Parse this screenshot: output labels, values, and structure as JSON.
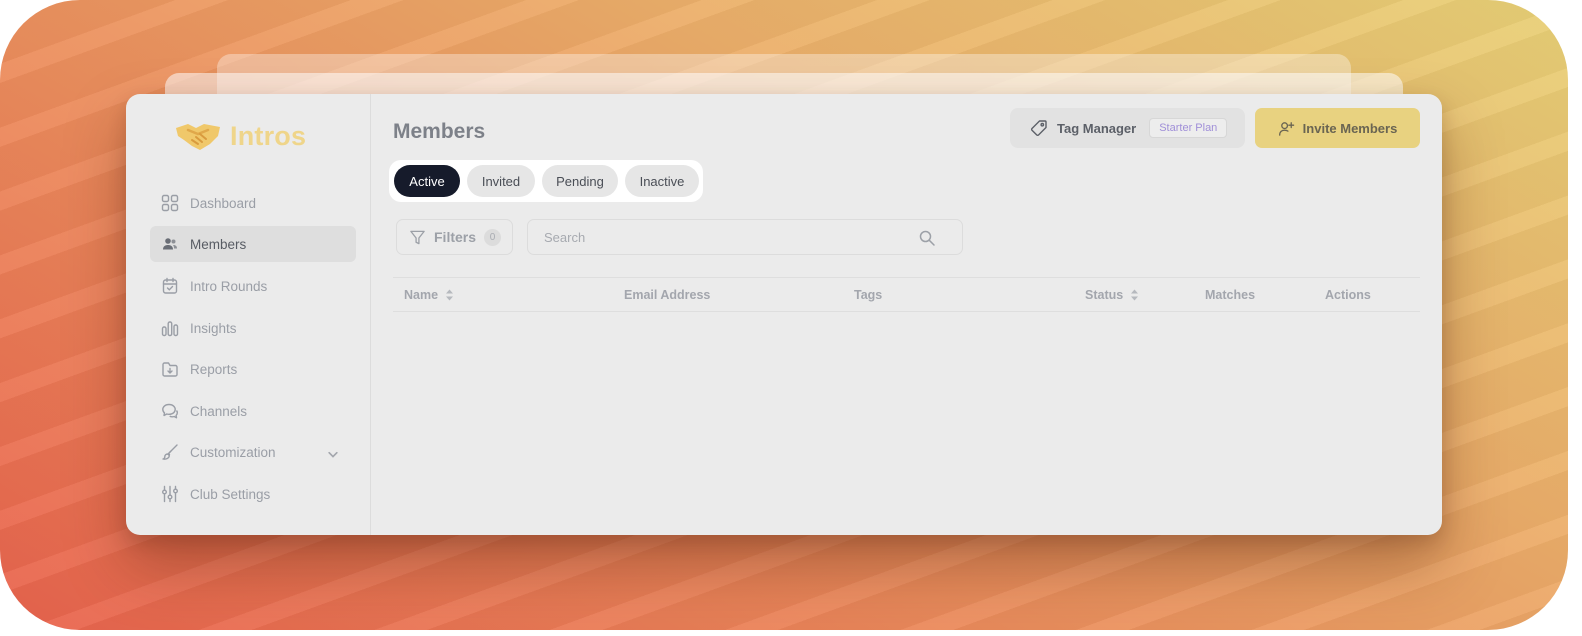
{
  "app": {
    "name": "Intros"
  },
  "sidebar": {
    "items": [
      {
        "label": "Dashboard",
        "icon": "grid-icon"
      },
      {
        "label": "Members",
        "icon": "users-icon",
        "active": true
      },
      {
        "label": "Intro Rounds",
        "icon": "calendar-check-icon"
      },
      {
        "label": "Insights",
        "icon": "bar-chart-icon"
      },
      {
        "label": "Reports",
        "icon": "folder-download-icon"
      },
      {
        "label": "Channels",
        "icon": "chat-bubbles-icon"
      },
      {
        "label": "Customization",
        "icon": "brush-icon",
        "expandable": true
      },
      {
        "label": "Club Settings",
        "icon": "sliders-icon"
      }
    ]
  },
  "header": {
    "title": "Members",
    "tag_manager_label": "Tag Manager",
    "plan_badge": "Starter Plan",
    "invite_label": "Invite Members"
  },
  "tabs": [
    {
      "label": "Active",
      "active": true
    },
    {
      "label": "Invited"
    },
    {
      "label": "Pending"
    },
    {
      "label": "Inactive"
    }
  ],
  "filters": {
    "label": "Filters",
    "count": "0"
  },
  "search": {
    "placeholder": "Search"
  },
  "table": {
    "columns": [
      {
        "label": "Name",
        "sortable": true
      },
      {
        "label": "Email Address"
      },
      {
        "label": "Tags"
      },
      {
        "label": "Status",
        "sortable": true
      },
      {
        "label": "Matches"
      },
      {
        "label": "Actions"
      }
    ],
    "rows": []
  },
  "colors": {
    "accent_dark": "#161b2b",
    "invite_yellow": "#e8d280",
    "logo_gold": "#efd58a",
    "plan_purple": "#a08fd8"
  }
}
